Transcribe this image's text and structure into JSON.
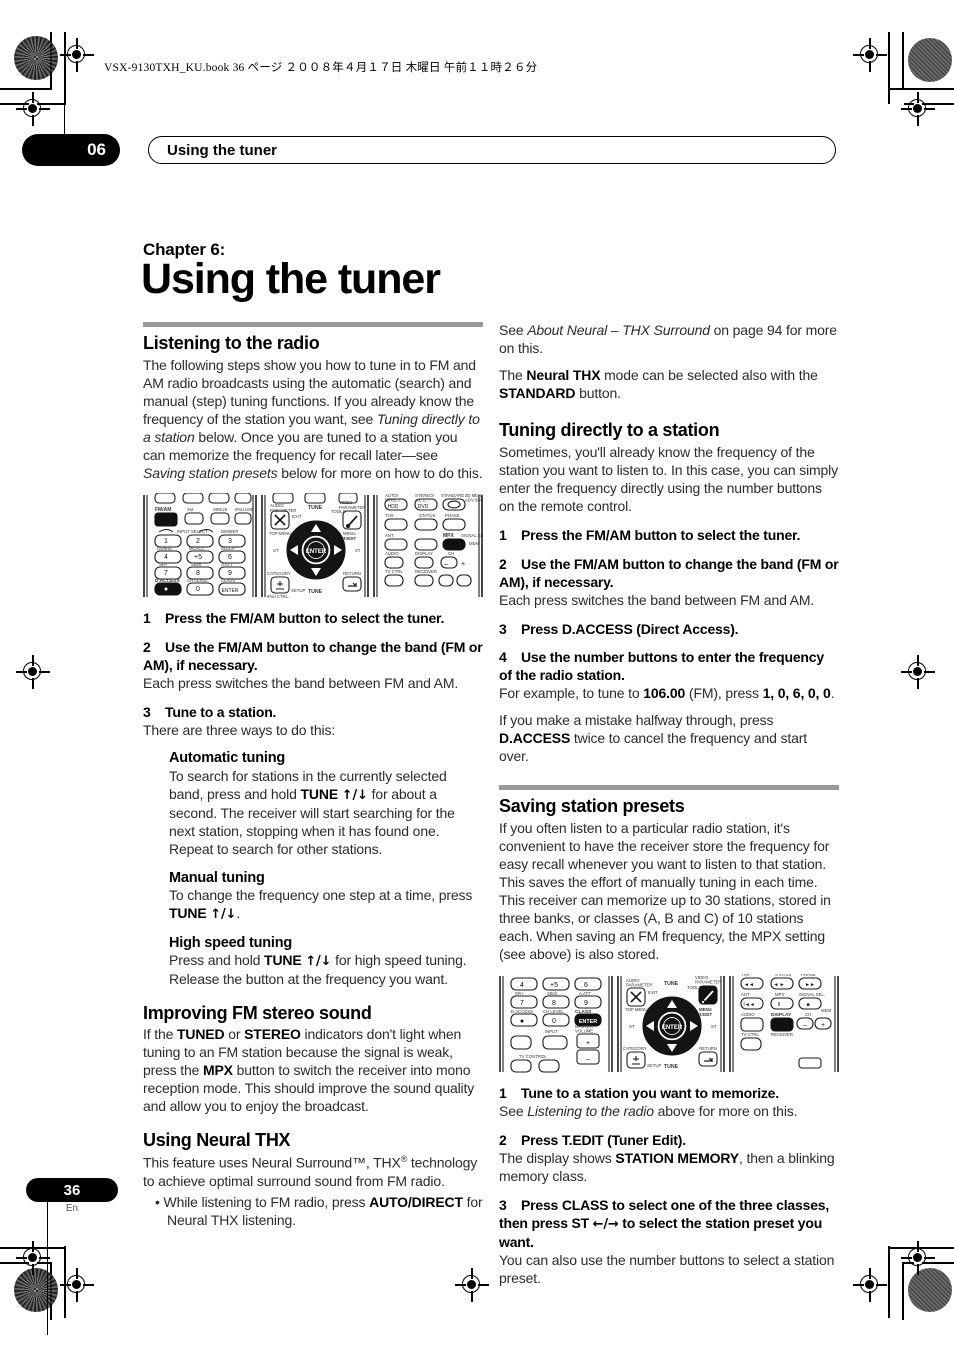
{
  "print_marks": {
    "file_info": "VSX-9130TXH_KU.book   36 ページ   ２００８年４月１７日   木曜日   午前１１時２６分"
  },
  "header": {
    "chapter_number": "06",
    "running_title": "Using the tuner"
  },
  "title_block": {
    "chapter_label": "Chapter 6:",
    "chapter_title": "Using the tuner"
  },
  "left_column": {
    "section1": {
      "heading": "Listening to the radio",
      "intro_1": "The following steps show you how to tune in to FM and AM radio broadcasts using the automatic (search) and manual (step) tuning functions. If you already know the frequency of the station you want, see ",
      "intro_1_italic_a": "Tuning directly to a station",
      "intro_1_mid": " below. Once you are tuned to a station you can memorize the frequency for recall later—see ",
      "intro_1_italic_b": "Saving station presets",
      "intro_1_end": " below for more on how to do this."
    },
    "steps": [
      {
        "number": "1",
        "title": "Press the FM/AM button to select the tuner.",
        "body": ""
      },
      {
        "number": "2",
        "title": "Use the FM/AM button to change the band (FM or AM), if necessary.",
        "body": "Each press switches the band between FM and AM."
      },
      {
        "number": "3",
        "title": "Tune to a station.",
        "body": "There are three ways to do this:"
      }
    ],
    "tuning_modes": [
      {
        "heading": "Automatic tuning",
        "body_pre": "To search for stations in the currently selected band, press and hold ",
        "bold": "TUNE",
        "arrows": "↑/↓",
        "body_post": " for about a second. The receiver will start searching for the next station, stopping when it has found one. Repeat to search for other stations."
      },
      {
        "heading": "Manual tuning",
        "body_pre": "To change the frequency one step at a time, press ",
        "bold": "TUNE",
        "arrows": "↑/↓",
        "body_post": "."
      },
      {
        "heading": "High speed tuning",
        "body_pre": "Press and hold ",
        "bold": "TUNE",
        "arrows": "↑/↓",
        "body_post": " for high speed tuning. Release the button at the frequency you want."
      }
    ],
    "fm_stereo": {
      "heading": "Improving FM stereo sound",
      "p_1": "If the ",
      "b_tuned": "TUNED",
      "p_2": " or ",
      "b_stereo": "STEREO",
      "p_3": " indicators don't light when tuning to an FM station because the signal is weak, press the ",
      "b_mpx": "MPX",
      "p_4": " button to switch the receiver into mono reception mode. This should improve the sound quality and allow you to enjoy the broadcast."
    },
    "neural_thx": {
      "heading": "Using Neural THX",
      "p_1": "This feature uses Neural Surround™, THX",
      "sup": "®",
      "p_2": " technology to achieve optimal surround sound from FM radio.",
      "bullet_pre": "While listening to FM radio, press ",
      "bullet_bold": "AUTO/DIRECT",
      "bullet_post": " for Neural THX listening."
    }
  },
  "right_column": {
    "neural_note": {
      "p1_pre": "See ",
      "p1_italic": "About Neural – THX Surround",
      "p1_post": " on page 94 for more on this.",
      "p2_pre": "The ",
      "p2_bold_a": "Neural THX",
      "p2_mid": " mode can be selected also with the ",
      "p2_bold_b": "STANDARD",
      "p2_post": " button."
    },
    "direct_tuning": {
      "heading": "Tuning directly to a station",
      "intro": "Sometimes, you'll already know the frequency of the station you want to listen to. In this case, you can simply enter the frequency directly using the number buttons on the remote control.",
      "steps": [
        {
          "number": "1",
          "title": "Press the FM/AM button to select the tuner.",
          "body": ""
        },
        {
          "number": "2",
          "title": "Use the FM/AM button to change the band (FM or AM), if necessary.",
          "body": "Each press switches the band between FM and AM."
        },
        {
          "number": "3",
          "title": "Press D.ACCESS (Direct Access).",
          "body": ""
        },
        {
          "number": "4",
          "title": "Use the number buttons to enter the frequency of the radio station.",
          "body": ""
        }
      ],
      "example_pre": "For example, to tune to ",
      "example_freq": "106.00",
      "example_mid": " (FM), press ",
      "example_keys": "1, 0, 6, 0, 0",
      "example_end": ".",
      "mistake_pre": "If you make a mistake halfway through, press ",
      "mistake_bold": "D.ACCESS",
      "mistake_post": " twice to cancel the frequency and start over."
    },
    "presets": {
      "heading": "Saving station presets",
      "intro": "If you often listen to a particular radio station, it's convenient to have the receiver store the frequency for easy recall whenever you want to listen to that station. This saves the effort of manually tuning in each time. This receiver can memorize up to 30 stations, stored in three banks, or classes (A, B and C) of 10 stations each. When saving an FM frequency, the MPX setting (see above) is also stored.",
      "steps": [
        {
          "number": "1",
          "title": "Tune to a station you want to memorize.",
          "body_pre": "See ",
          "body_italic": "Listening to the radio",
          "body_post": " above for more on this."
        },
        {
          "number": "2",
          "title": "Press T.EDIT (Tuner Edit).",
          "body_pre": "The display shows ",
          "body_bold": "STATION MEMORY",
          "body_post": ", then a blinking memory class."
        },
        {
          "number": "3",
          "title_pre": "Press CLASS to select one of the three classes, then press ST ",
          "title_arrows": "←/→",
          "title_post": " to select the station preset you want.",
          "body": "You can also use the number buttons to select a station preset."
        }
      ]
    }
  },
  "footer": {
    "page_number": "36",
    "language": "En"
  },
  "remote_figure_1": {
    "label": "remote-control-diagram-tuner-buttons",
    "panel_left": {
      "row_top": [
        "FM/AM",
        "XM",
        "SIRIUS",
        "iPod USB"
      ],
      "input_select_label": "INPUT SELECT",
      "dimmer_label": "DIMMER",
      "keys": [
        "1",
        "2",
        "3",
        "4",
        "+5",
        "6",
        "7",
        "8",
        "9",
        "●",
        "0",
        "ENTER"
      ],
      "key_captions": [
        "GENRE",
        "MCACC",
        "SLEEP",
        "SR+",
        "SBch",
        "A.ATT",
        "D.ACCESS",
        "CH LEVEL",
        "CLASS"
      ],
      "highlighted": [
        "FM/AM",
        "D.ACCESS"
      ]
    },
    "panel_mid": {
      "labels_top": [
        "AUDIO PARAMETER",
        "EXIT",
        "TUNE",
        "TOOLS",
        "VIDEO PARAMETER"
      ],
      "labels_mid": [
        "TOP MENU",
        "ST",
        "ENTER",
        "ST",
        "MENU T.EDIT"
      ],
      "labels_bottom": [
        "CATEGORY",
        "SETUP",
        "TUNE",
        "RETURN",
        "iPod CTRL"
      ]
    },
    "panel_right": {
      "labels": [
        "AUTO/DIRECT",
        "STEREO/A.L.C.",
        "STANDARD",
        "3D MENU ADV.SURR",
        "HDD",
        "DVD",
        "THX",
        "STATUS",
        "PHASE",
        "ANT",
        "MPX",
        "SIGNAL SEL.",
        "AUDIO",
        "DISPLAY",
        "CH",
        "TV CTRL",
        "RECEIVER"
      ],
      "highlighted": [
        "MPX"
      ]
    }
  },
  "remote_figure_2": {
    "label": "remote-control-diagram-preset-buttons",
    "panel_left": {
      "keys": [
        "4",
        "+5",
        "6",
        "7",
        "8",
        "9",
        "●",
        "0",
        "ENTER"
      ],
      "key_captions": [
        "SR+",
        "SBch",
        "A.ATT",
        "D.ACCESS",
        "CH LEVEL",
        "CLASS",
        "INPUT",
        "MASTER VOLUME",
        "TV CONTROL"
      ],
      "highlighted": [
        "ENTER"
      ]
    },
    "panel_mid": {
      "labels_top": [
        "AUDIO PARAMETER",
        "EXIT",
        "TUNE",
        "TOOLS",
        "VIDEO PARAMETER"
      ],
      "labels_mid": [
        "TOP MENU",
        "ST",
        "ENTER",
        "ST",
        "MENU T.EDIT"
      ],
      "labels_bottom": [
        "CATEGORY",
        "SETUP",
        "TUNE",
        "RETURN"
      ],
      "highlighted": [
        "MENU T.EDIT"
      ]
    },
    "panel_right": {
      "labels": [
        "ANT",
        "MPX",
        "SIGNAL SEL.",
        "AUDIO",
        "DISPLAY",
        "CH",
        "TV CTRL",
        "RECEIVER",
        "MEM"
      ],
      "highlighted": [
        "DISPLAY"
      ]
    }
  }
}
